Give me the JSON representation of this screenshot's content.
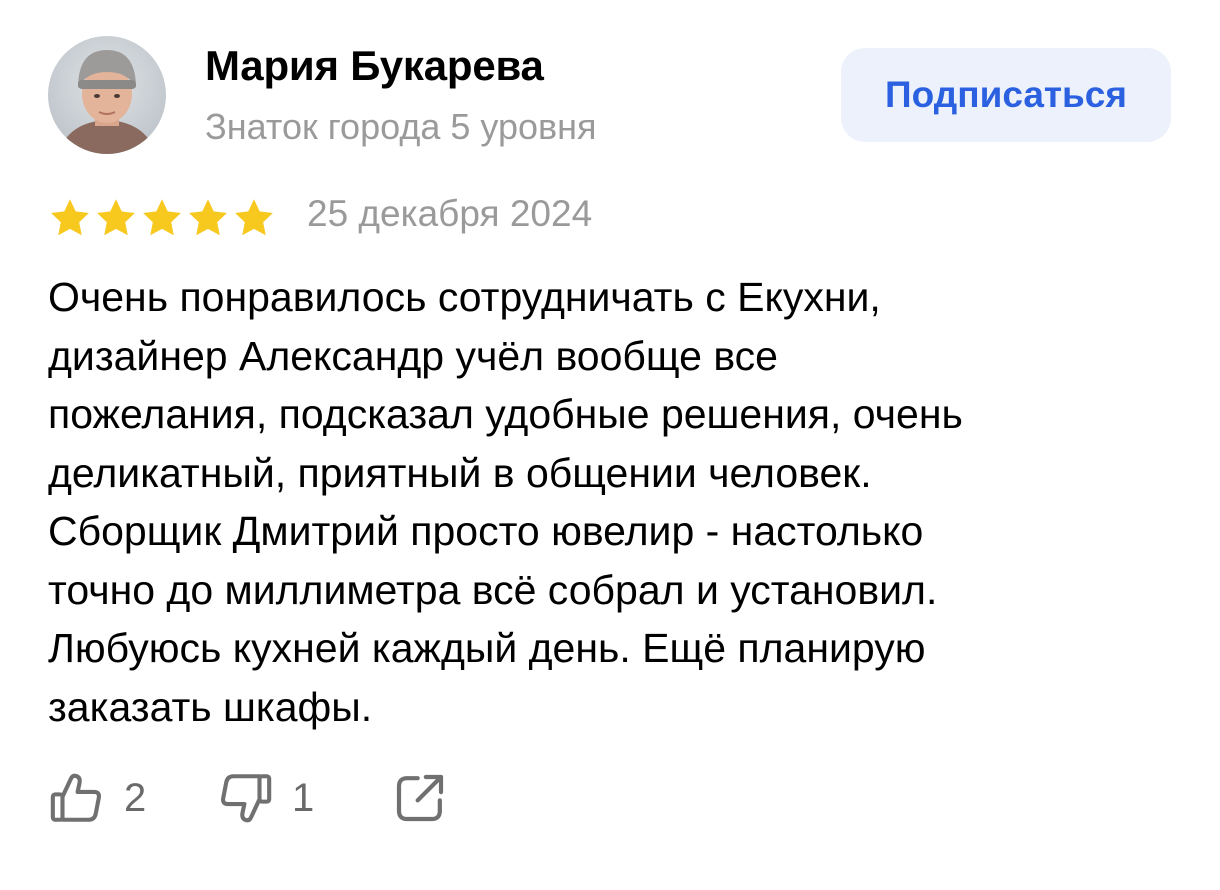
{
  "author": {
    "name": "Мария Букарева",
    "level": "Знаток города 5 уровня"
  },
  "subscribe_button": {
    "label": "Подписаться"
  },
  "review": {
    "rating": 5,
    "max_rating": 5,
    "date": "25 декабря 2024",
    "text_lines": [
      "Очень понравилось сотрудничать с Екухни,",
      "дизайнер Александр учёл вообще все",
      "пожелания, подсказал удобные решения, очень",
      "деликатный, приятный в общении человек.",
      "Сборщик Дмитрий просто ювелир - настолько",
      "точно до миллиметра всё собрал и установил.",
      "Любуюсь кухней каждый день. Ещё планирую",
      "заказать шкафы."
    ]
  },
  "reactions": {
    "likes": "2",
    "dislikes": "1"
  },
  "icons": {
    "like": "thumbs-up-icon",
    "dislike": "thumbs-down-icon",
    "share": "share-icon",
    "star": "star-icon"
  },
  "colors": {
    "star": "#f7c81e",
    "accent": "#2b61e0",
    "button_bg": "#edf1fb",
    "muted_text": "#9a9a9a"
  }
}
